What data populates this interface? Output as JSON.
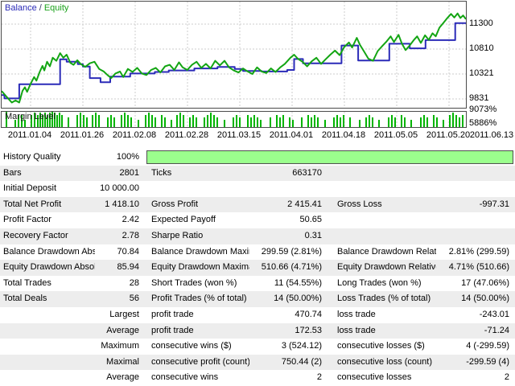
{
  "chart": {
    "legend": {
      "balance": "Balance",
      "sep": "/",
      "equity": "Equity"
    },
    "colors": {
      "balance_line": "#2b2bb8",
      "equity_line": "#13a513",
      "margin_bar": "#00b400",
      "grid": "#cdcdcd",
      "history_bar_fill": "#9bff8d",
      "history_bar_border": "#4f4f4f",
      "alt_row": "#ededed"
    }
  },
  "chart_data": {
    "type": "line",
    "title": "Balance / Equity",
    "y_tick_labels": [
      "11300",
      "10810",
      "10321",
      "9831"
    ],
    "y_grid_values": [
      11300,
      10810,
      10321,
      9831
    ],
    "ylim": [
      9660,
      11742
    ],
    "x_tick_labels": [
      "2011.01.04",
      "2011.01.26",
      "2011.02.08",
      "2011.02.28",
      "2011.03.15",
      "2011.04.01",
      "2011.04.18",
      "2011.05.05",
      "2011.05.20",
      "2011.06.13"
    ],
    "series": [
      {
        "name": "Balance",
        "step": true,
        "points": [
          [
            0.0,
            9905
          ],
          [
            0.006,
            9840
          ],
          [
            0.038,
            10120
          ],
          [
            0.126,
            10610
          ],
          [
            0.14,
            10560
          ],
          [
            0.164,
            10515
          ],
          [
            0.175,
            10465
          ],
          [
            0.19,
            10240
          ],
          [
            0.213,
            10160
          ],
          [
            0.234,
            10270
          ],
          [
            0.277,
            10330
          ],
          [
            0.33,
            10360
          ],
          [
            0.36,
            10390
          ],
          [
            0.415,
            10430
          ],
          [
            0.465,
            10460
          ],
          [
            0.502,
            10420
          ],
          [
            0.52,
            10380
          ],
          [
            0.56,
            10370
          ],
          [
            0.615,
            10400
          ],
          [
            0.63,
            10615
          ],
          [
            0.649,
            10530
          ],
          [
            0.732,
            10880
          ],
          [
            0.768,
            10585
          ],
          [
            0.835,
            10915
          ],
          [
            0.879,
            10825
          ],
          [
            0.913,
            10985
          ],
          [
            0.977,
            11320
          ],
          [
            1.0,
            11320
          ]
        ]
      },
      {
        "name": "Equity",
        "step": false,
        "points": [
          [
            0.0,
            9985
          ],
          [
            0.01,
            9880
          ],
          [
            0.022,
            9760
          ],
          [
            0.03,
            9800
          ],
          [
            0.038,
            9760
          ],
          [
            0.045,
            9990
          ],
          [
            0.05,
            10060
          ],
          [
            0.055,
            9970
          ],
          [
            0.062,
            10120
          ],
          [
            0.07,
            10260
          ],
          [
            0.075,
            10190
          ],
          [
            0.082,
            10360
          ],
          [
            0.088,
            10480
          ],
          [
            0.092,
            10390
          ],
          [
            0.098,
            10560
          ],
          [
            0.104,
            10470
          ],
          [
            0.11,
            10640
          ],
          [
            0.118,
            10580
          ],
          [
            0.126,
            10730
          ],
          [
            0.133,
            10640
          ],
          [
            0.14,
            10700
          ],
          [
            0.148,
            10540
          ],
          [
            0.155,
            10500
          ],
          [
            0.163,
            10590
          ],
          [
            0.17,
            10520
          ],
          [
            0.18,
            10460
          ],
          [
            0.19,
            10530
          ],
          [
            0.2,
            10560
          ],
          [
            0.21,
            10420
          ],
          [
            0.22,
            10370
          ],
          [
            0.228,
            10300
          ],
          [
            0.236,
            10240
          ],
          [
            0.245,
            10330
          ],
          [
            0.255,
            10370
          ],
          [
            0.262,
            10260
          ],
          [
            0.272,
            10420
          ],
          [
            0.282,
            10360
          ],
          [
            0.292,
            10440
          ],
          [
            0.302,
            10330
          ],
          [
            0.312,
            10300
          ],
          [
            0.322,
            10400
          ],
          [
            0.332,
            10440
          ],
          [
            0.342,
            10350
          ],
          [
            0.352,
            10470
          ],
          [
            0.362,
            10500
          ],
          [
            0.372,
            10400
          ],
          [
            0.382,
            10550
          ],
          [
            0.39,
            10450
          ],
          [
            0.4,
            10400
          ],
          [
            0.41,
            10500
          ],
          [
            0.42,
            10560
          ],
          [
            0.43,
            10440
          ],
          [
            0.44,
            10520
          ],
          [
            0.45,
            10430
          ],
          [
            0.46,
            10580
          ],
          [
            0.47,
            10490
          ],
          [
            0.48,
            10580
          ],
          [
            0.49,
            10450
          ],
          [
            0.5,
            10390
          ],
          [
            0.51,
            10350
          ],
          [
            0.52,
            10430
          ],
          [
            0.53,
            10370
          ],
          [
            0.54,
            10320
          ],
          [
            0.55,
            10450
          ],
          [
            0.56,
            10370
          ],
          [
            0.57,
            10340
          ],
          [
            0.58,
            10430
          ],
          [
            0.59,
            10360
          ],
          [
            0.6,
            10450
          ],
          [
            0.61,
            10520
          ],
          [
            0.622,
            10640
          ],
          [
            0.63,
            10700
          ],
          [
            0.638,
            10620
          ],
          [
            0.648,
            10560
          ],
          [
            0.658,
            10470
          ],
          [
            0.668,
            10570
          ],
          [
            0.678,
            10640
          ],
          [
            0.688,
            10520
          ],
          [
            0.698,
            10610
          ],
          [
            0.708,
            10700
          ],
          [
            0.718,
            10780
          ],
          [
            0.728,
            10690
          ],
          [
            0.738,
            10850
          ],
          [
            0.748,
            10940
          ],
          [
            0.755,
            10840
          ],
          [
            0.765,
            11030
          ],
          [
            0.772,
            10890
          ],
          [
            0.78,
            10770
          ],
          [
            0.79,
            10620
          ],
          [
            0.8,
            10580
          ],
          [
            0.81,
            10770
          ],
          [
            0.82,
            10870
          ],
          [
            0.828,
            10950
          ],
          [
            0.838,
            11060
          ],
          [
            0.845,
            10950
          ],
          [
            0.855,
            11090
          ],
          [
            0.862,
            10920
          ],
          [
            0.87,
            10790
          ],
          [
            0.878,
            10870
          ],
          [
            0.888,
            10990
          ],
          [
            0.895,
            11060
          ],
          [
            0.903,
            10930
          ],
          [
            0.912,
            11080
          ],
          [
            0.92,
            10990
          ],
          [
            0.928,
            11120
          ],
          [
            0.935,
            11060
          ],
          [
            0.943,
            11230
          ],
          [
            0.952,
            11330
          ],
          [
            0.96,
            11420
          ],
          [
            0.968,
            11500
          ],
          [
            0.975,
            11430
          ],
          [
            0.982,
            11510
          ],
          [
            0.988,
            11420
          ],
          [
            0.994,
            11470
          ],
          [
            1.0,
            11400
          ]
        ]
      }
    ],
    "margin_chart": {
      "label": "Margin Level",
      "y_tick_labels": [
        "9073%",
        "5886%"
      ],
      "bars": [
        [
          5,
          19
        ],
        [
          16,
          9
        ],
        [
          20,
          15
        ],
        [
          24,
          15
        ],
        [
          28,
          9
        ],
        [
          36,
          15
        ],
        [
          40,
          18
        ],
        [
          44,
          15
        ],
        [
          47,
          18
        ],
        [
          50,
          15
        ],
        [
          53,
          18
        ],
        [
          56,
          15
        ],
        [
          59,
          18
        ],
        [
          62,
          19
        ],
        [
          65,
          18
        ],
        [
          68,
          15
        ],
        [
          71,
          18
        ],
        [
          74,
          15
        ],
        [
          82,
          12
        ],
        [
          93,
          15
        ],
        [
          97,
          18
        ],
        [
          101,
          15
        ],
        [
          105,
          12
        ],
        [
          112,
          15
        ],
        [
          116,
          18
        ],
        [
          120,
          15
        ],
        [
          131,
          12
        ],
        [
          135,
          15
        ],
        [
          139,
          12
        ],
        [
          148,
          15
        ],
        [
          152,
          18
        ],
        [
          156,
          15
        ],
        [
          160,
          12
        ],
        [
          169,
          9
        ],
        [
          178,
          15
        ],
        [
          182,
          18
        ],
        [
          186,
          15
        ],
        [
          190,
          12
        ],
        [
          198,
          15
        ],
        [
          202,
          12
        ],
        [
          210,
          9
        ],
        [
          217,
          15
        ],
        [
          221,
          18
        ],
        [
          225,
          15
        ],
        [
          233,
          12
        ],
        [
          237,
          15
        ],
        [
          241,
          12
        ],
        [
          251,
          12
        ],
        [
          255,
          15
        ],
        [
          259,
          18
        ],
        [
          263,
          15
        ],
        [
          267,
          12
        ],
        [
          276,
          9
        ],
        [
          287,
          12
        ],
        [
          291,
          15
        ],
        [
          295,
          12
        ],
        [
          305,
          15
        ],
        [
          309,
          12
        ],
        [
          313,
          15
        ],
        [
          317,
          12
        ],
        [
          321,
          9
        ],
        [
          333,
          12
        ],
        [
          341,
          15
        ],
        [
          345,
          12
        ],
        [
          349,
          15
        ],
        [
          357,
          12
        ],
        [
          361,
          9
        ],
        [
          372,
          12
        ],
        [
          380,
          15
        ],
        [
          384,
          12
        ],
        [
          388,
          15
        ],
        [
          392,
          12
        ],
        [
          401,
          9
        ],
        [
          412,
          12
        ],
        [
          416,
          15
        ],
        [
          420,
          12
        ],
        [
          424,
          15
        ],
        [
          432,
          12
        ],
        [
          444,
          9
        ],
        [
          452,
          12
        ],
        [
          456,
          15
        ],
        [
          460,
          12
        ],
        [
          468,
          9
        ],
        [
          480,
          12
        ],
        [
          484,
          15
        ],
        [
          488,
          12
        ],
        [
          496,
          15
        ],
        [
          500,
          12
        ],
        [
          508,
          9
        ],
        [
          520,
          12
        ],
        [
          524,
          15
        ],
        [
          528,
          12
        ],
        [
          536,
          15
        ],
        [
          540,
          12
        ],
        [
          548,
          9
        ],
        [
          556,
          15
        ],
        [
          560,
          18
        ],
        [
          564,
          15
        ],
        [
          568,
          12
        ],
        [
          572,
          15
        ]
      ]
    }
  },
  "table": {
    "rows": [
      {
        "c1l": "History Quality",
        "c1v": "100%",
        "progress": true
      },
      {
        "c1l": "Bars",
        "c1v": "2801",
        "c2l": "Ticks",
        "c2v": "663170"
      },
      {
        "c1l": "Initial Deposit",
        "c1v": "10 000.00"
      },
      {
        "c1l": "Total Net Profit",
        "c1v": "1 418.10",
        "c2l": "Gross Profit",
        "c2v": "2 415.41",
        "c3l": "Gross Loss",
        "c3v": "-997.31"
      },
      {
        "c1l": "Profit Factor",
        "c1v": "2.42",
        "c2l": "Expected Payoff",
        "c2v": "50.65"
      },
      {
        "c1l": "Recovery Factor",
        "c1v": "2.78",
        "c2l": "Sharpe Ratio",
        "c2v": "0.31"
      },
      {
        "c1l": "Balance Drawdown Absolute",
        "c1v": "70.84",
        "c2l": "Balance Drawdown Maximal",
        "c2v": "299.59 (2.81%)",
        "c3l": "Balance Drawdown Relative",
        "c3v": "2.81% (299.59)"
      },
      {
        "c1l": "Equity Drawdown Absolute",
        "c1v": "85.94",
        "c2l": "Equity Drawdown Maximal",
        "c2v": "510.66 (4.71%)",
        "c3l": "Equity Drawdown Relative",
        "c3v": "4.71% (510.66)"
      },
      {
        "c1l": "Total Trades",
        "c1v": "28",
        "c2l": "Short Trades (won %)",
        "c2v": "11 (54.55%)",
        "c3l": "Long Trades (won %)",
        "c3v": "17 (47.06%)"
      },
      {
        "c1l": "Total Deals",
        "c1v": "56",
        "c2l": "Profit Trades (% of total)",
        "c2v": "14 (50.00%)",
        "c3l": "Loss Trades (% of total)",
        "c3v": "14 (50.00%)"
      },
      {
        "c1v": "Largest",
        "c2l": "profit trade",
        "c2v": "470.74",
        "c3l": "loss trade",
        "c3v": "-243.01"
      },
      {
        "c1v": "Average",
        "c2l": "profit trade",
        "c2v": "172.53",
        "c3l": "loss trade",
        "c3v": "-71.24"
      },
      {
        "c1v": "Maximum",
        "c2l": "consecutive wins ($)",
        "c2v": "3 (524.12)",
        "c3l": "consecutive losses ($)",
        "c3v": "4 (-299.59)"
      },
      {
        "c1v": "Maximal",
        "c2l": "consecutive profit (count)",
        "c2v": "750.44 (2)",
        "c3l": "consecutive loss (count)",
        "c3v": "-299.59 (4)"
      },
      {
        "c1v": "Average",
        "c2l": "consecutive wins",
        "c2v": "2",
        "c3l": "consecutive losses",
        "c3v": "2"
      }
    ]
  }
}
